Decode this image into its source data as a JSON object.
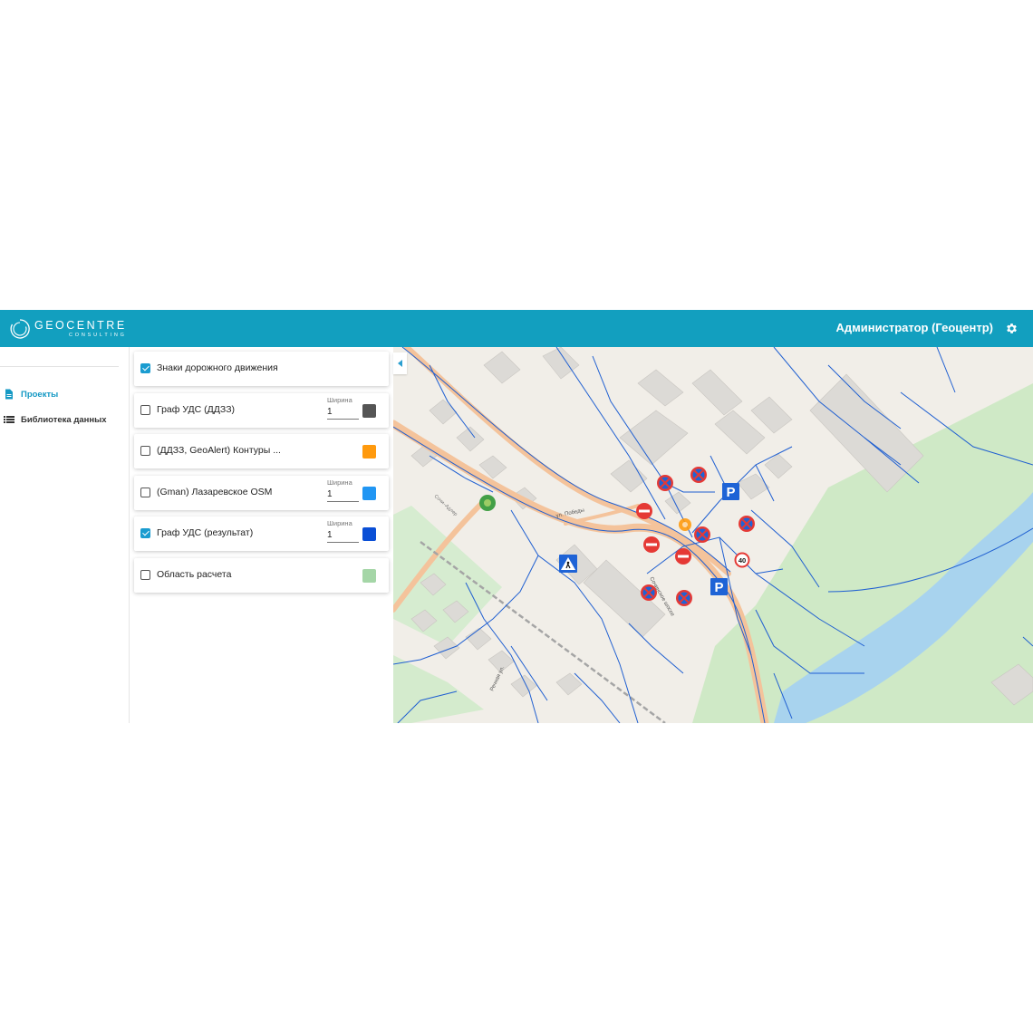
{
  "header": {
    "logo_name": "GEOCENTRE",
    "logo_sub": "CONSULTING",
    "user_name": "Администратор (Геоцентр)",
    "settings_icon": "gear-icon",
    "color": "#129fbf"
  },
  "sidebar": {
    "items": [
      {
        "label": "Проекты",
        "icon": "document-icon",
        "active": true
      },
      {
        "label": "Библиотека данных",
        "icon": "list-icon",
        "active": false
      }
    ]
  },
  "layers": [
    {
      "name": "Знаки дорожного движения",
      "checked": true
    },
    {
      "name": "Граф УДС (ДДЗЗ)",
      "checked": false,
      "width_label": "Ширина",
      "width": "1",
      "color": "#555555"
    },
    {
      "name": "(ДДЗЗ, GeoAlert) Контуры ...",
      "checked": false,
      "color": "#ff9a0e"
    },
    {
      "name": "(Gman) Лазаревское OSM",
      "checked": false,
      "width_label": "Ширина",
      "width": "1",
      "color": "#2196f3"
    },
    {
      "name": "Граф УДС (результат)",
      "checked": true,
      "width_label": "Ширина",
      "width": "1",
      "color": "#0a4fd6"
    },
    {
      "name": "Область расчета",
      "checked": false,
      "color": "#a5d6a7"
    }
  ],
  "map": {
    "street_labels": [
      "ул. Победы",
      "Сочинское шоссе",
      "Речная ул.",
      "Сочи–Адлер"
    ],
    "speed_limit": "40",
    "parking_label": "P",
    "sign_icons": [
      "no-stopping-sign-icon",
      "no-entry-sign-icon",
      "parking-sign-icon",
      "speed-limit-sign-icon",
      "pedestrian-crossing-sign-icon"
    ]
  }
}
